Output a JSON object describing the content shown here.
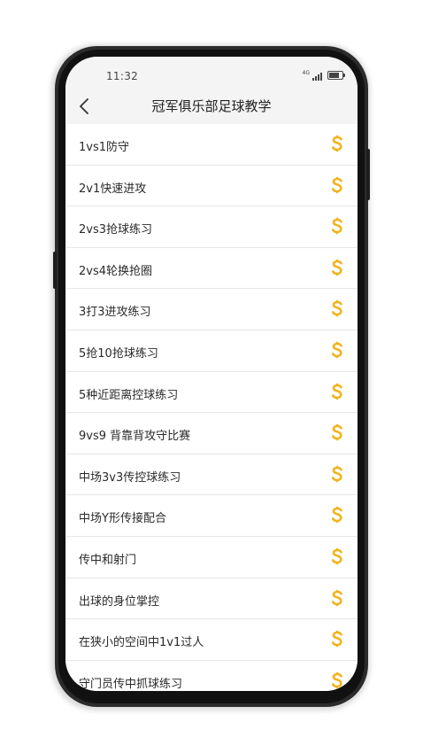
{
  "status_bar": {
    "time": "11:32",
    "network": "4G",
    "signal_bars": 4,
    "battery_level": 0.8
  },
  "header": {
    "title": "冠军俱乐部足球教学"
  },
  "list": {
    "items": [
      {
        "label": "1vs1防守"
      },
      {
        "label": "2v1快速进攻"
      },
      {
        "label": "2vs3抢球练习"
      },
      {
        "label": "2vs4轮换抢圈"
      },
      {
        "label": "3打3进攻练习"
      },
      {
        "label": "5抢10抢球练习"
      },
      {
        "label": "5种近距离控球练习"
      },
      {
        "label": "9vs9 背靠背攻守比赛"
      },
      {
        "label": "中场3v3传控球练习"
      },
      {
        "label": "中场Y形传接配合"
      },
      {
        "label": "传中和射门"
      },
      {
        "label": "出球的身位掌控"
      },
      {
        "label": "在狭小的空间中1v1过人"
      },
      {
        "label": "守门员传中抓球练习"
      }
    ],
    "item_icon": "s-coin-icon",
    "icon_color": "#f2b31b"
  },
  "colors": {
    "header_bg": "#f4f4f4",
    "divider": "#e6e6e6",
    "phone_frame": "#2b2b2d"
  }
}
